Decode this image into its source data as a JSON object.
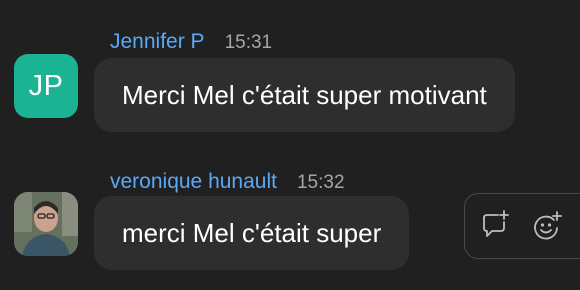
{
  "messages": [
    {
      "sender": "Jennifer P",
      "time": "15:31",
      "avatar_initials": "JP",
      "text": "Merci Mel c'était super motivant"
    },
    {
      "sender": "veronique hunault",
      "time": "15:32",
      "avatar_icon": "user-photo",
      "text": "merci Mel c'était super"
    }
  ],
  "hover_actions": [
    {
      "icon": "reply-in-thread-icon"
    },
    {
      "icon": "add-reaction-icon"
    }
  ],
  "colors": {
    "background": "#202020",
    "bubble": "#2e2e2e",
    "sender_name": "#5aa9f6",
    "timestamp": "#a6a6a6",
    "avatar_jp": "#1ab394"
  }
}
